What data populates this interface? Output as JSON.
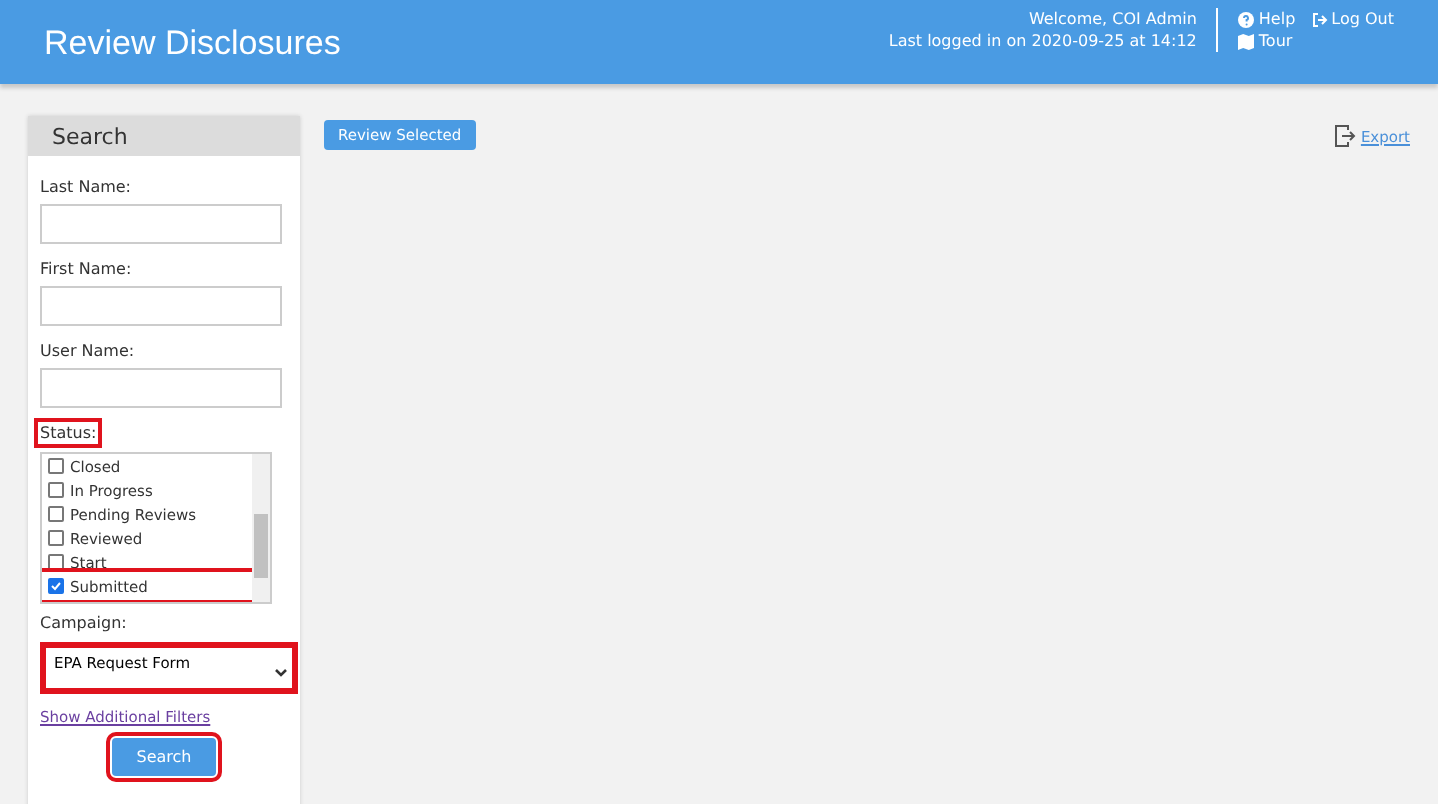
{
  "header": {
    "title": "Review Disclosures",
    "welcome": "Welcome, COI Admin",
    "last_login": "Last logged in on 2020-09-25 at 14:12",
    "links": [
      {
        "label": "Help",
        "kind": "help"
      },
      {
        "label": "Log Out",
        "kind": "logout"
      },
      {
        "label": "Tour",
        "kind": "tour"
      }
    ]
  },
  "search_panel": {
    "title": "Search",
    "fields": [
      {
        "label": "Last Name:"
      },
      {
        "label": "First Name:"
      },
      {
        "label": "User Name:"
      }
    ],
    "status": {
      "label": "Status:",
      "highlighted": true,
      "options": [
        {
          "label": "Closed",
          "checked": false,
          "highlighted": false
        },
        {
          "label": "In Progress",
          "checked": false,
          "highlighted": false
        },
        {
          "label": "Pending Reviews",
          "checked": false,
          "highlighted": false
        },
        {
          "label": "Reviewed",
          "checked": false,
          "highlighted": false
        },
        {
          "label": "Start",
          "checked": false,
          "highlighted": false
        },
        {
          "label": "Submitted",
          "checked": true,
          "highlighted": true
        }
      ]
    },
    "campaign": {
      "label": "Campaign:",
      "value": "EPA Request Form",
      "highlighted": true
    },
    "more_filters_link": "Show Additional Filters",
    "search_button": {
      "label": "Search",
      "highlighted": true
    }
  },
  "toolbar": {
    "review_button": "Review Selected",
    "export_link": "Export"
  }
}
